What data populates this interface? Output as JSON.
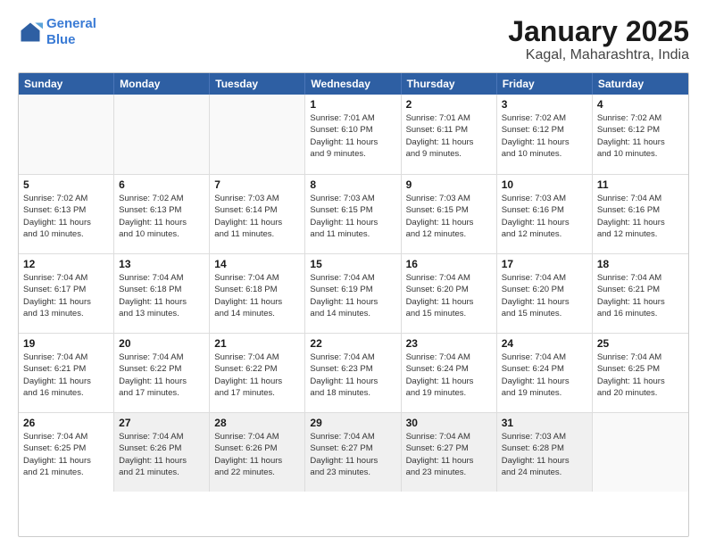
{
  "header": {
    "logo_line1": "General",
    "logo_line2": "Blue",
    "title": "January 2025",
    "subtitle": "Kagal, Maharashtra, India"
  },
  "calendar": {
    "weekdays": [
      "Sunday",
      "Monday",
      "Tuesday",
      "Wednesday",
      "Thursday",
      "Friday",
      "Saturday"
    ],
    "weeks": [
      [
        {
          "day": "",
          "info": "",
          "empty": true
        },
        {
          "day": "",
          "info": "",
          "empty": true
        },
        {
          "day": "",
          "info": "",
          "empty": true
        },
        {
          "day": "1",
          "info": "Sunrise: 7:01 AM\nSunset: 6:10 PM\nDaylight: 11 hours\nand 9 minutes.",
          "empty": false
        },
        {
          "day": "2",
          "info": "Sunrise: 7:01 AM\nSunset: 6:11 PM\nDaylight: 11 hours\nand 9 minutes.",
          "empty": false
        },
        {
          "day": "3",
          "info": "Sunrise: 7:02 AM\nSunset: 6:12 PM\nDaylight: 11 hours\nand 10 minutes.",
          "empty": false
        },
        {
          "day": "4",
          "info": "Sunrise: 7:02 AM\nSunset: 6:12 PM\nDaylight: 11 hours\nand 10 minutes.",
          "empty": false
        }
      ],
      [
        {
          "day": "5",
          "info": "Sunrise: 7:02 AM\nSunset: 6:13 PM\nDaylight: 11 hours\nand 10 minutes.",
          "empty": false
        },
        {
          "day": "6",
          "info": "Sunrise: 7:02 AM\nSunset: 6:13 PM\nDaylight: 11 hours\nand 10 minutes.",
          "empty": false
        },
        {
          "day": "7",
          "info": "Sunrise: 7:03 AM\nSunset: 6:14 PM\nDaylight: 11 hours\nand 11 minutes.",
          "empty": false
        },
        {
          "day": "8",
          "info": "Sunrise: 7:03 AM\nSunset: 6:15 PM\nDaylight: 11 hours\nand 11 minutes.",
          "empty": false
        },
        {
          "day": "9",
          "info": "Sunrise: 7:03 AM\nSunset: 6:15 PM\nDaylight: 11 hours\nand 12 minutes.",
          "empty": false
        },
        {
          "day": "10",
          "info": "Sunrise: 7:03 AM\nSunset: 6:16 PM\nDaylight: 11 hours\nand 12 minutes.",
          "empty": false
        },
        {
          "day": "11",
          "info": "Sunrise: 7:04 AM\nSunset: 6:16 PM\nDaylight: 11 hours\nand 12 minutes.",
          "empty": false
        }
      ],
      [
        {
          "day": "12",
          "info": "Sunrise: 7:04 AM\nSunset: 6:17 PM\nDaylight: 11 hours\nand 13 minutes.",
          "empty": false
        },
        {
          "day": "13",
          "info": "Sunrise: 7:04 AM\nSunset: 6:18 PM\nDaylight: 11 hours\nand 13 minutes.",
          "empty": false
        },
        {
          "day": "14",
          "info": "Sunrise: 7:04 AM\nSunset: 6:18 PM\nDaylight: 11 hours\nand 14 minutes.",
          "empty": false
        },
        {
          "day": "15",
          "info": "Sunrise: 7:04 AM\nSunset: 6:19 PM\nDaylight: 11 hours\nand 14 minutes.",
          "empty": false
        },
        {
          "day": "16",
          "info": "Sunrise: 7:04 AM\nSunset: 6:20 PM\nDaylight: 11 hours\nand 15 minutes.",
          "empty": false
        },
        {
          "day": "17",
          "info": "Sunrise: 7:04 AM\nSunset: 6:20 PM\nDaylight: 11 hours\nand 15 minutes.",
          "empty": false
        },
        {
          "day": "18",
          "info": "Sunrise: 7:04 AM\nSunset: 6:21 PM\nDaylight: 11 hours\nand 16 minutes.",
          "empty": false
        }
      ],
      [
        {
          "day": "19",
          "info": "Sunrise: 7:04 AM\nSunset: 6:21 PM\nDaylight: 11 hours\nand 16 minutes.",
          "empty": false
        },
        {
          "day": "20",
          "info": "Sunrise: 7:04 AM\nSunset: 6:22 PM\nDaylight: 11 hours\nand 17 minutes.",
          "empty": false
        },
        {
          "day": "21",
          "info": "Sunrise: 7:04 AM\nSunset: 6:22 PM\nDaylight: 11 hours\nand 17 minutes.",
          "empty": false
        },
        {
          "day": "22",
          "info": "Sunrise: 7:04 AM\nSunset: 6:23 PM\nDaylight: 11 hours\nand 18 minutes.",
          "empty": false
        },
        {
          "day": "23",
          "info": "Sunrise: 7:04 AM\nSunset: 6:24 PM\nDaylight: 11 hours\nand 19 minutes.",
          "empty": false
        },
        {
          "day": "24",
          "info": "Sunrise: 7:04 AM\nSunset: 6:24 PM\nDaylight: 11 hours\nand 19 minutes.",
          "empty": false
        },
        {
          "day": "25",
          "info": "Sunrise: 7:04 AM\nSunset: 6:25 PM\nDaylight: 11 hours\nand 20 minutes.",
          "empty": false
        }
      ],
      [
        {
          "day": "26",
          "info": "Sunrise: 7:04 AM\nSunset: 6:25 PM\nDaylight: 11 hours\nand 21 minutes.",
          "empty": false
        },
        {
          "day": "27",
          "info": "Sunrise: 7:04 AM\nSunset: 6:26 PM\nDaylight: 11 hours\nand 21 minutes.",
          "empty": false
        },
        {
          "day": "28",
          "info": "Sunrise: 7:04 AM\nSunset: 6:26 PM\nDaylight: 11 hours\nand 22 minutes.",
          "empty": false
        },
        {
          "day": "29",
          "info": "Sunrise: 7:04 AM\nSunset: 6:27 PM\nDaylight: 11 hours\nand 23 minutes.",
          "empty": false
        },
        {
          "day": "30",
          "info": "Sunrise: 7:04 AM\nSunset: 6:27 PM\nDaylight: 11 hours\nand 23 minutes.",
          "empty": false
        },
        {
          "day": "31",
          "info": "Sunrise: 7:03 AM\nSunset: 6:28 PM\nDaylight: 11 hours\nand 24 minutes.",
          "empty": false
        },
        {
          "day": "",
          "info": "",
          "empty": true
        }
      ]
    ]
  }
}
